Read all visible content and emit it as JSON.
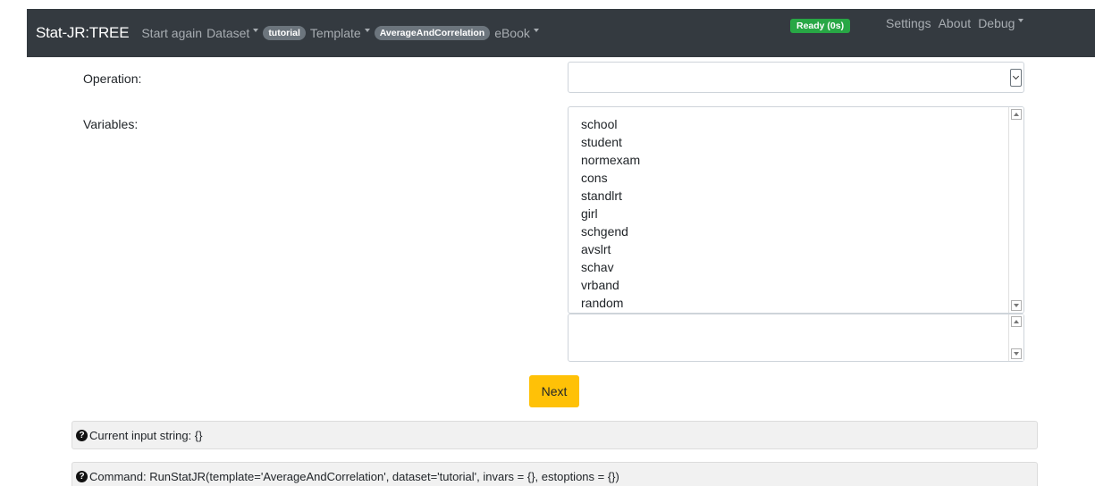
{
  "navbar": {
    "brand": "Stat-JR:TREE",
    "start_again": "Start again",
    "dataset_label": "Dataset",
    "dataset_value": "tutorial",
    "template_label": "Template",
    "template_value": "AverageAndCorrelation",
    "ebook_label": "eBook",
    "status": "Ready (0s)",
    "settings": "Settings",
    "about": "About",
    "debug": "Debug"
  },
  "form": {
    "operation_label": "Operation:",
    "operation_value": "",
    "variables_label": "Variables:",
    "variables": [
      "school",
      "student",
      "normexam",
      "cons",
      "standlrt",
      "girl",
      "schgend",
      "avslrt",
      "schav",
      "vrband",
      "random"
    ],
    "selected_text": "",
    "next_label": "Next"
  },
  "info": {
    "current_input": "Current input string: {}",
    "command": "Command: RunStatJR(template='AverageAndCorrelation', dataset='tutorial', invars = {}, estoptions = {})"
  },
  "icons": {
    "help": "question-circle-icon",
    "dropdown": "caret-down-icon",
    "select_arrow": "chevron-down-icon"
  },
  "colors": {
    "navbar_bg": "#343a40",
    "pill_bg": "#6c757d",
    "ready_bg": "#28a745",
    "next_bg": "#ffc107",
    "info_bg": "#f1f1f1"
  }
}
